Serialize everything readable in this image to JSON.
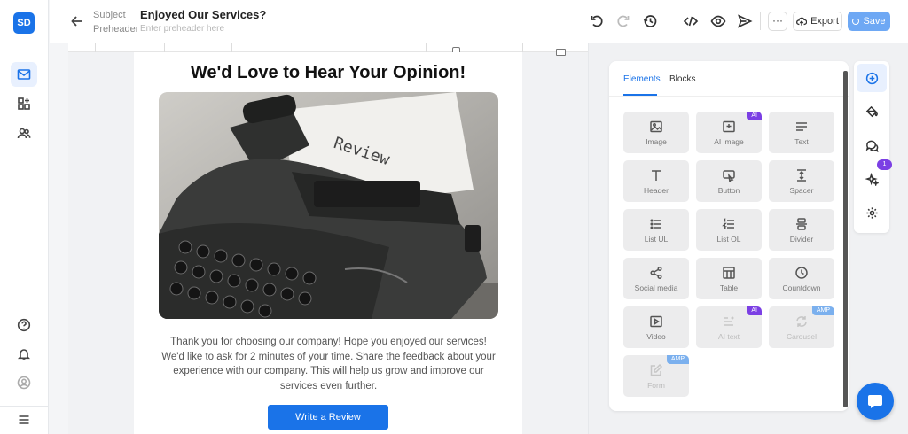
{
  "app": {
    "logo_text": "SD"
  },
  "topbar": {
    "subject_label": "Subject",
    "preheader_label": "Preheader",
    "subject_value": "Enjoyed Our Services?",
    "preheader_placeholder": "Enter preheader here",
    "more_label": "···",
    "export_label": "Export",
    "save_label": "Save"
  },
  "email": {
    "title": "We'd Love to Hear Your Opinion!",
    "body": "Thank you for choosing our company! Hope you enjoyed our services! We'd like to ask for 2 minutes of your time. Share the feedback about your experience with our company. This will help us grow and improve our services even further.",
    "cta_label": "Write a Review",
    "hero_paper_text": "Review"
  },
  "panel": {
    "tabs": [
      "Elements",
      "Blocks"
    ],
    "elements": [
      {
        "label": "Image",
        "icon": "image-icon"
      },
      {
        "label": "AI image",
        "icon": "ai-image-icon",
        "badge": "AI"
      },
      {
        "label": "Text",
        "icon": "text-icon"
      },
      {
        "label": "Header",
        "icon": "header-icon"
      },
      {
        "label": "Button",
        "icon": "button-icon"
      },
      {
        "label": "Spacer",
        "icon": "spacer-icon"
      },
      {
        "label": "List UL",
        "icon": "list-ul-icon"
      },
      {
        "label": "List OL",
        "icon": "list-ol-icon"
      },
      {
        "label": "Divider",
        "icon": "divider-icon"
      },
      {
        "label": "Social media",
        "icon": "share-icon"
      },
      {
        "label": "Table",
        "icon": "table-icon"
      },
      {
        "label": "Countdown",
        "icon": "clock-icon"
      },
      {
        "label": "Video",
        "icon": "video-icon"
      },
      {
        "label": "AI text",
        "icon": "ai-text-icon",
        "badge": "AI",
        "disabled": true
      },
      {
        "label": "Carousel",
        "icon": "carousel-icon",
        "badge": "AMP",
        "disabled": true
      },
      {
        "label": "Form",
        "icon": "form-icon",
        "badge": "AMP",
        "disabled": true
      }
    ]
  },
  "rail": {
    "ai_badge": "1"
  },
  "colors": {
    "accent": "#1a73e8",
    "ai_badge": "#7b3fe4",
    "amp_badge": "#7bb0ee"
  }
}
